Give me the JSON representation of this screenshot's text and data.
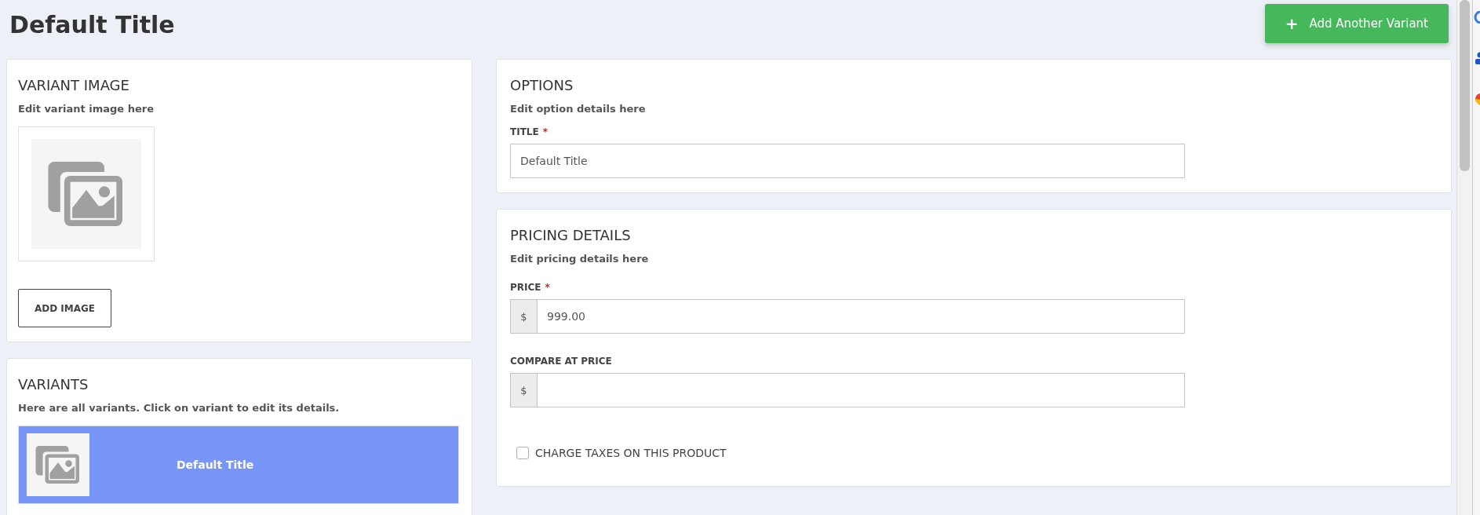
{
  "page": {
    "title": "Default Title",
    "add_button": {
      "icon": "+",
      "label": "Add Another Variant"
    }
  },
  "variant_image": {
    "heading": "VARIANT IMAGE",
    "subtitle": "Edit variant image here",
    "button": "ADD IMAGE"
  },
  "variants": {
    "heading": "VARIANTS",
    "subtitle": "Here are all variants. Click on variant to edit its details.",
    "items": [
      {
        "title": "Default Title",
        "selected": true
      }
    ]
  },
  "options": {
    "heading": "OPTIONS",
    "subtitle": "Edit option details here",
    "fields": [
      {
        "label": "TITLE",
        "required_mark": "*",
        "value": "Default Title"
      }
    ]
  },
  "pricing": {
    "heading": "PRICING DETAILS",
    "subtitle": "Edit pricing details here",
    "fields": [
      {
        "label": "PRICE",
        "required_mark": "*",
        "prefix": "$",
        "value": "999.00"
      },
      {
        "label": "COMPARE AT PRICE",
        "prefix": "$"
      }
    ],
    "checkbox": {
      "label": "CHARGE TAXES ON THIS PRODUCT",
      "checked": false
    }
  }
}
